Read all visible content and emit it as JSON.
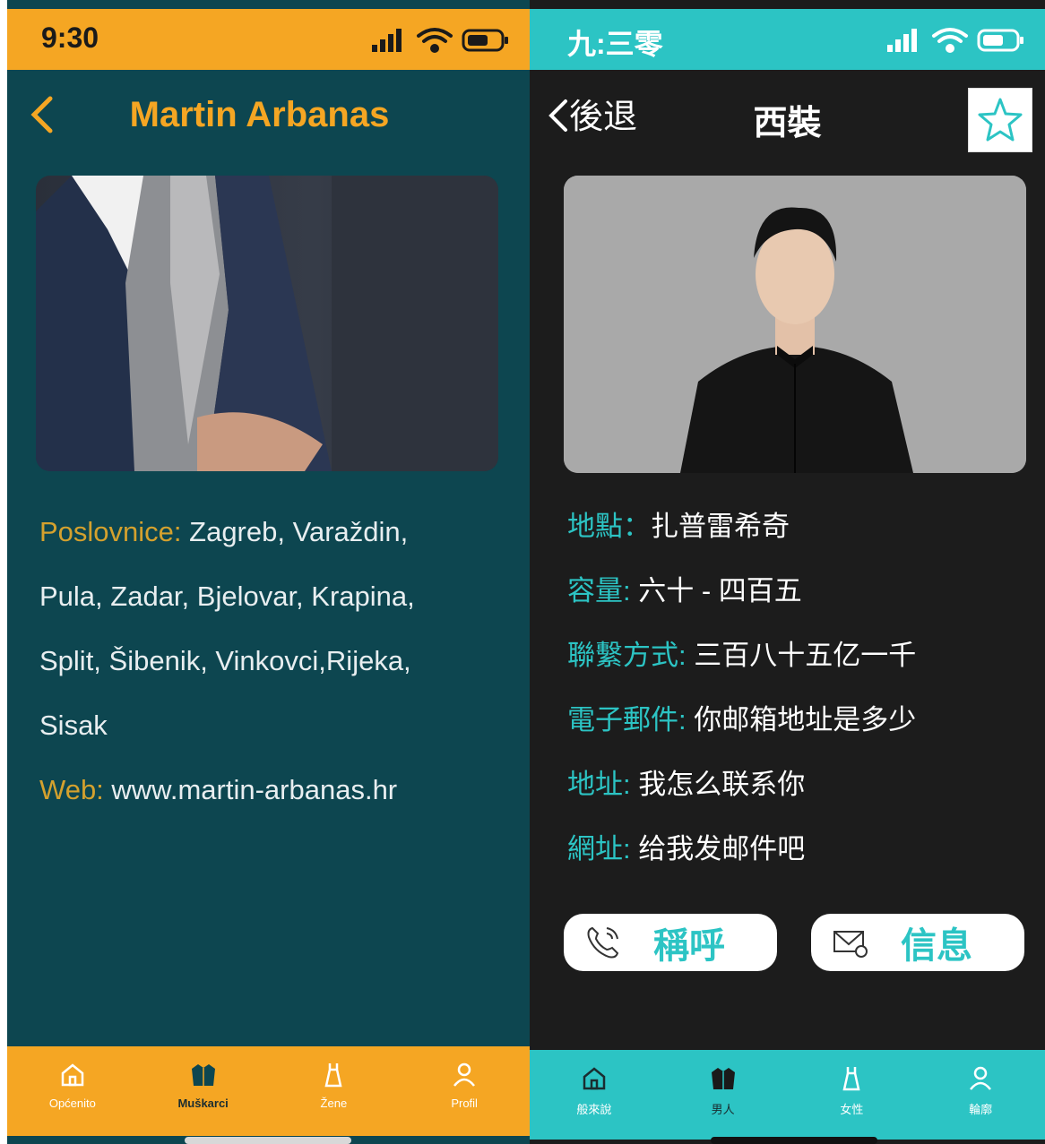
{
  "left": {
    "status": {
      "time": "9:30"
    },
    "header": {
      "title": "Martin Arbanas"
    },
    "info": {
      "branches_label": "Poslovnice:",
      "branches_lines": [
        " Zagreb, Varaždin,",
        "Pula, Zadar, Bjelovar, Krapina,",
        "Split, Šibenik, Vinkovci,Rijeka,",
        "Sisak"
      ],
      "web_label": "Web:",
      "web_value": " www.martin-arbanas.hr"
    },
    "tabs": [
      "Općenito",
      "Muškarci",
      "Žene",
      "Profil"
    ],
    "active_tab": "Muškarci",
    "colors": {
      "accent": "#f5a623",
      "background": "#0d4650",
      "label": "#d4a12e"
    }
  },
  "right": {
    "status": {
      "time": "九:三零"
    },
    "header": {
      "back_label": "後退",
      "title": "西裝"
    },
    "info": [
      {
        "label": "地點：",
        "value": "扎普雷希奇"
      },
      {
        "label": "容量:",
        "value": " 六十 - 四百五"
      },
      {
        "label": "聯繫方式:",
        "value": " 三百八十五亿一千"
      },
      {
        "label": "電子郵件:",
        "value": " 你邮箱地址是多少"
      },
      {
        "label": "地址:",
        "value": " 我怎么联系你"
      },
      {
        "label": "網址:",
        "value": " 给我发邮件吧"
      }
    ],
    "actions": {
      "call": "稱呼",
      "message": "信息"
    },
    "tabs": [
      "般來說",
      "男人",
      "女性",
      "輪廓"
    ],
    "active_tab": "男人",
    "colors": {
      "accent": "#2cc4c4",
      "background": "#1c1c1c"
    }
  }
}
